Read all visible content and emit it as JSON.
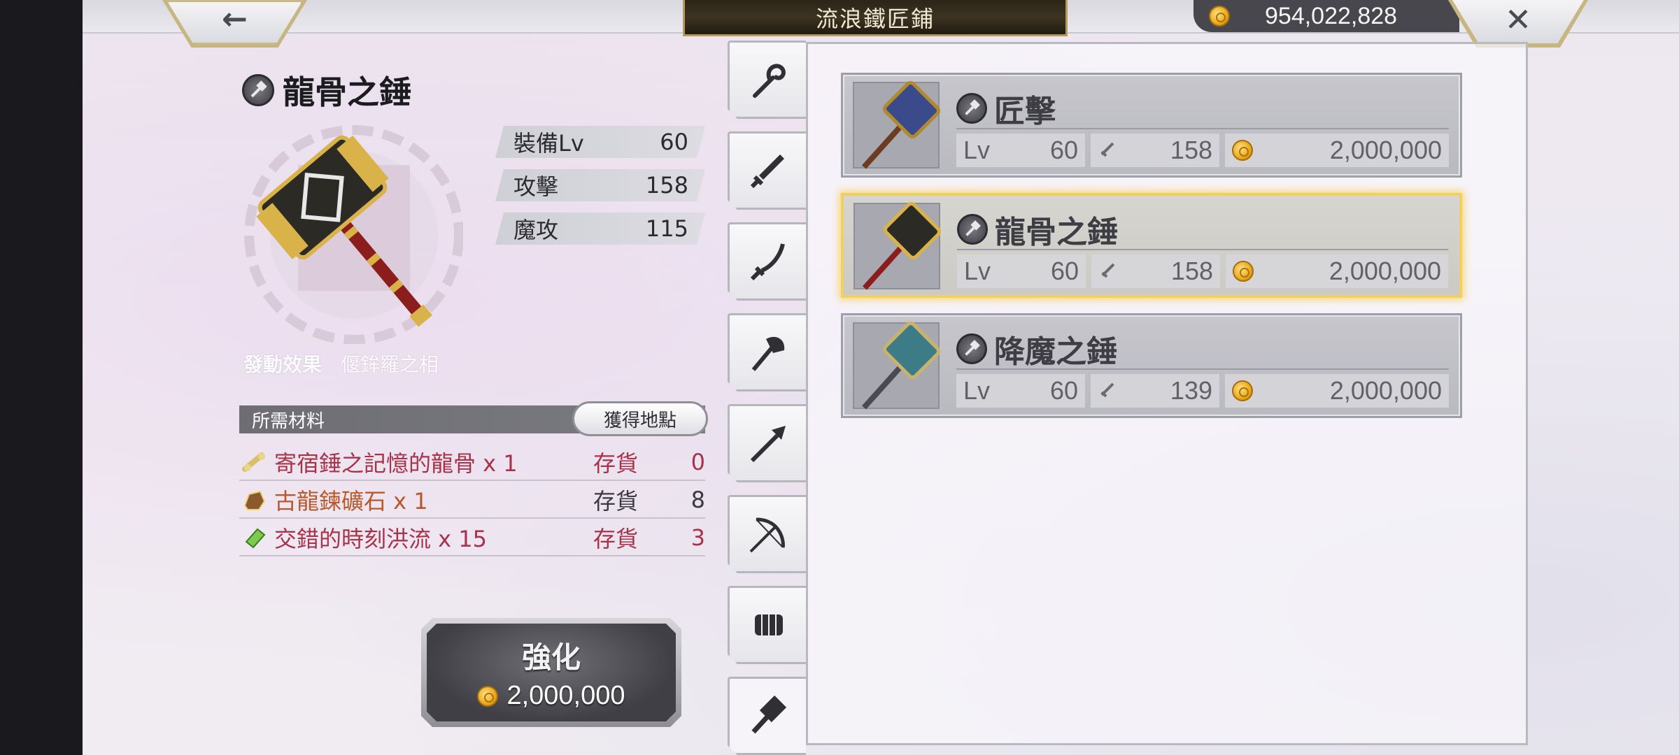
{
  "header": {
    "title": "流浪鐵匠鋪",
    "currency": "954,022,828",
    "back_icon": "arrow-left-icon",
    "close_icon": "close-icon"
  },
  "detail": {
    "name": "龍骨之錘",
    "stats": [
      {
        "label": "裝備Lv",
        "value": "60"
      },
      {
        "label": "攻擊",
        "value": "158"
      },
      {
        "label": "魔攻",
        "value": "115"
      }
    ],
    "effect_label": "發動效果",
    "effect_value": "偃鉾羅之相"
  },
  "materials": {
    "header": "所需材料",
    "obtain_label": "獲得地點",
    "items": [
      {
        "name": "寄宿錘之記憶的龍骨 x 1",
        "stock_label": "存貨",
        "stock": "0",
        "color": "#a8324a"
      },
      {
        "name": "古龍鍊礦石 x 1",
        "stock_label": "存貨",
        "stock": "8",
        "color": "#b8592a"
      },
      {
        "name": "交錯的時刻洪流 x 15",
        "stock_label": "存貨",
        "stock": "3",
        "color": "#a8324a"
      }
    ]
  },
  "upgrade": {
    "label": "強化",
    "cost": "2,000,000"
  },
  "tabs": [
    "staff",
    "sword",
    "katana",
    "axe",
    "spear",
    "bow",
    "fist",
    "hammer"
  ],
  "weapons": [
    {
      "name": "匠擊",
      "lv_label": "Lv",
      "lv": "60",
      "atk": "158",
      "cost": "2,000,000",
      "selected": false
    },
    {
      "name": "龍骨之錘",
      "lv_label": "Lv",
      "lv": "60",
      "atk": "158",
      "cost": "2,000,000",
      "selected": true
    },
    {
      "name": "降魔之錘",
      "lv_label": "Lv",
      "lv": "60",
      "atk": "139",
      "cost": "2,000,000",
      "selected": false
    }
  ],
  "colors": {
    "accent_gold": "#f2cf62",
    "stock_zero": "#a8324a"
  }
}
